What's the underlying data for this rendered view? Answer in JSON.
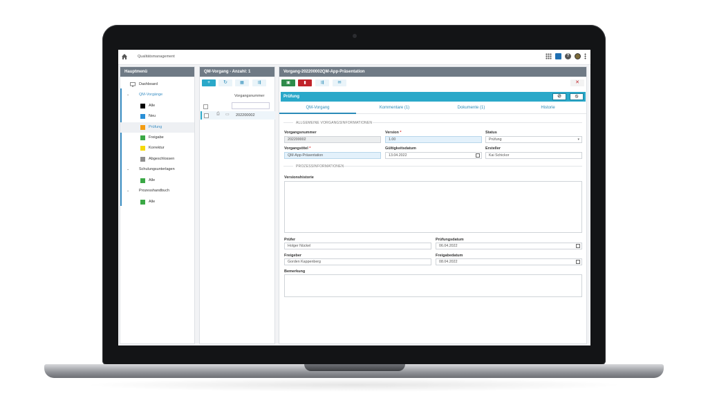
{
  "topbar": {
    "breadcrumb": "Qualitätsmanagement"
  },
  "sidebar": {
    "title": "Hauptmenü",
    "items": [
      {
        "label": "Dashboard"
      },
      {
        "label": "QM-Vorgänge"
      },
      {
        "label": "Alle",
        "color": "#000000"
      },
      {
        "label": "Neu",
        "color": "#2b8fd6"
      },
      {
        "label": "Prüfung",
        "color": "#f39c12"
      },
      {
        "label": "Freigabe",
        "color": "#3aa845"
      },
      {
        "label": "Korrektur",
        "color": "#f5d90a"
      },
      {
        "label": "Abgeschlossen",
        "color": "#8f8f8f"
      },
      {
        "label": "Schulungsunterlagen"
      },
      {
        "label": "Alle",
        "color": "#3aa845"
      },
      {
        "label": "Prozesshandbuch"
      },
      {
        "label": "Alle",
        "color": "#3aa845"
      }
    ]
  },
  "list": {
    "title": "QM-Vorgang - Anzahl: 1",
    "column_header": "Vorgangsnummer",
    "rows": [
      {
        "number": "202200002"
      }
    ],
    "toolbar_colors": {
      "primary": "#2aa8c9"
    }
  },
  "detail": {
    "title": "Vorgang-202200002QM-App-Präsentation",
    "status_title": "Prüfung",
    "tabs": [
      {
        "label": "QM-Vorgang"
      },
      {
        "label": "Kommentare (1)"
      },
      {
        "label": "Dokumente (1)"
      },
      {
        "label": "Historie"
      }
    ],
    "section_general": "ALLGEMEINE VORGANGSINFORMATIONEN",
    "section_process": "PROZESSINFORMATIONEN",
    "fields": {
      "vorgangsnummer_label": "Vorgangsnummer",
      "vorgangsnummer": "202200002",
      "version_label": "Version",
      "version": "1.00",
      "status_label": "Status",
      "status": "Prüfung",
      "titel_label": "Vorgangstitel",
      "titel": "QM-App-Präsentation",
      "gueltig_label": "Gültigkeitsdatum",
      "gueltig": "13.04.2022",
      "ersteller_label": "Ersteller",
      "ersteller": "Kai Schickor",
      "versionshistorie_label": "Versionshistorie",
      "pruefer_label": "Prüfer",
      "pruefer": "Holger Nückel",
      "pruefungsdatum_label": "Prüfungsdatum",
      "pruefungsdatum": "06.04.2022",
      "freigeber_label": "Freigeber",
      "freigeber": "Gorden Kappenberg",
      "freigabedatum_label": "Freigabedatum",
      "freigabedatum": "08.04.2022",
      "bemerkung_label": "Bemerkung"
    },
    "colors": {
      "save": "#2e8b4a",
      "delete": "#c0242b",
      "status": "#2aa8c9"
    }
  }
}
